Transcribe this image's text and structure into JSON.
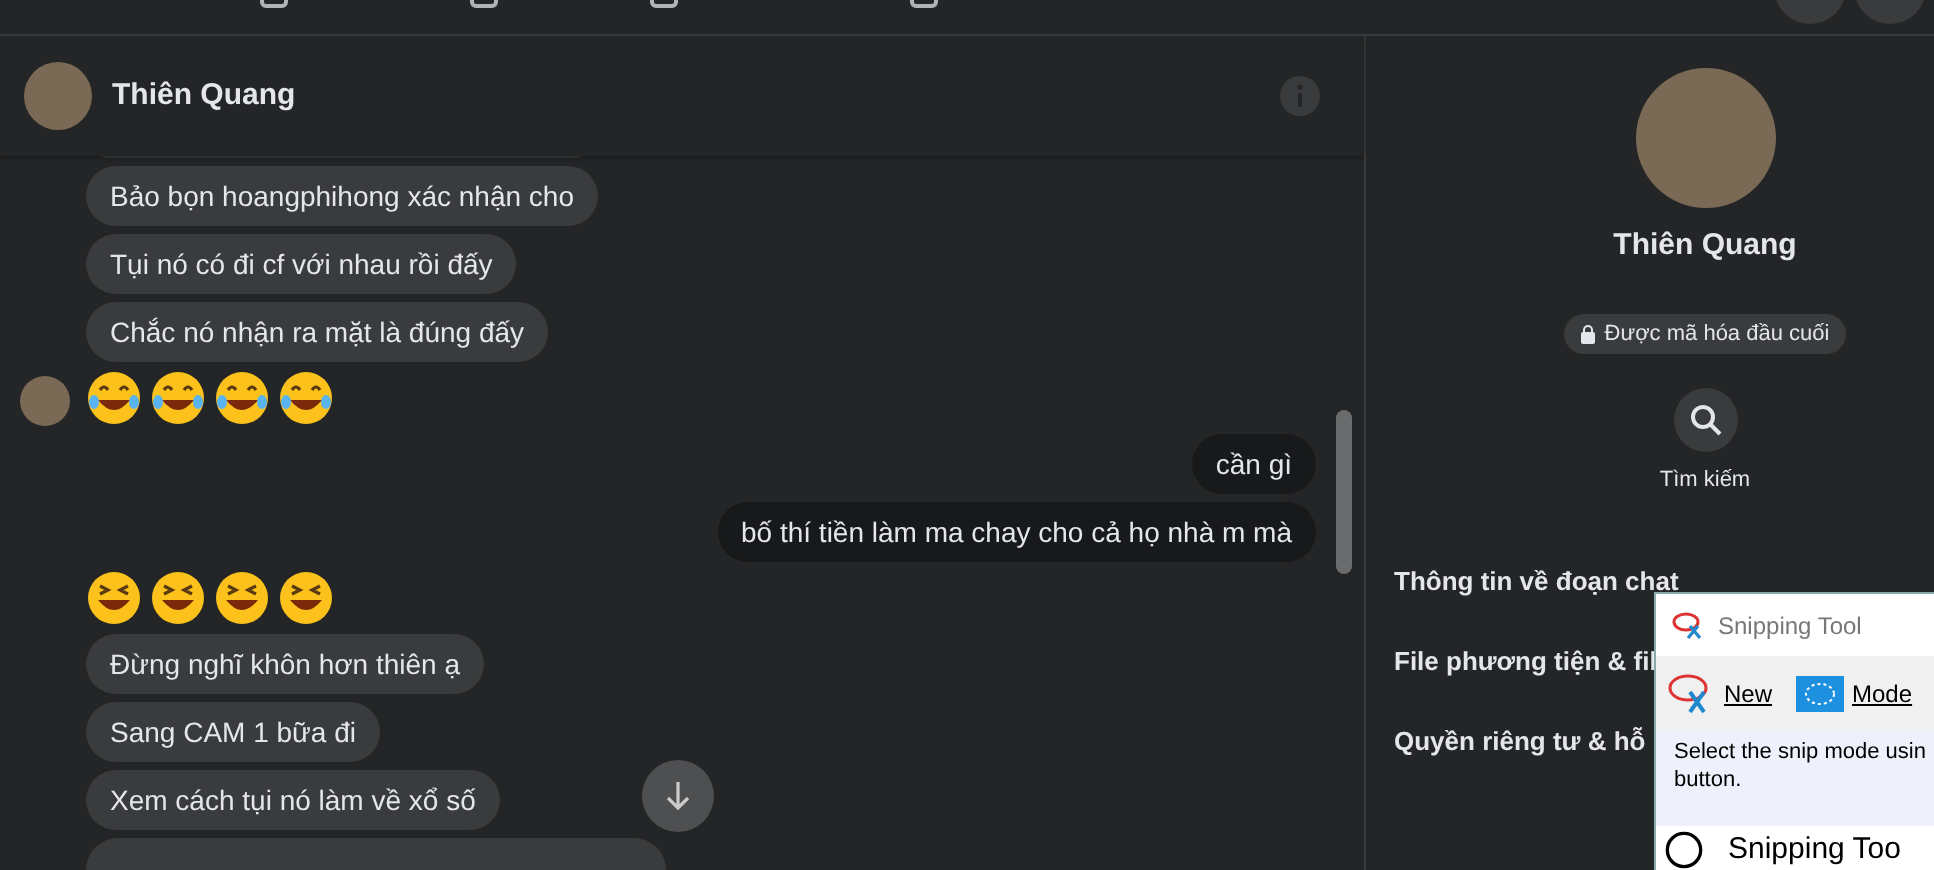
{
  "chat_header": {
    "name": "Thiên Quang"
  },
  "messages": [
    {
      "outgoing": false,
      "kind": "text",
      "text": "Bảo bọn hoangphihong xác nhận cho",
      "avatar": false
    },
    {
      "outgoing": false,
      "kind": "text",
      "text": "Tụi nó có đi cf với nhau rồi đấy",
      "avatar": false
    },
    {
      "outgoing": false,
      "kind": "text",
      "text": "Chắc nó nhận ra mặt là đúng đấy",
      "avatar": false
    },
    {
      "outgoing": false,
      "kind": "emoji",
      "emoji": [
        {
          "kind": "tears"
        },
        {
          "kind": "tears"
        },
        {
          "kind": "tears"
        },
        {
          "kind": "tears"
        }
      ],
      "avatar": true
    },
    {
      "outgoing": true,
      "kind": "text",
      "text": "cần gì"
    },
    {
      "outgoing": true,
      "kind": "text",
      "text": "bố thí tiền làm ma chay cho cả họ nhà m mà"
    },
    {
      "outgoing": false,
      "kind": "emoji",
      "emoji": [
        {
          "kind": "grin"
        },
        {
          "kind": "grin"
        },
        {
          "kind": "grin"
        },
        {
          "kind": "grin"
        }
      ],
      "avatar": false
    },
    {
      "outgoing": false,
      "kind": "text",
      "text": "Đừng nghĩ khôn hơn thiên ạ",
      "avatar": false
    },
    {
      "outgoing": false,
      "kind": "text",
      "text": "Sang CAM 1 bữa đi",
      "avatar": false
    },
    {
      "outgoing": false,
      "kind": "text",
      "text": "Xem cách tụi nó làm về xổ số",
      "avatar": false
    }
  ],
  "profile": {
    "name": "Thiên Quang",
    "encryption_badge": "Được mã hóa đầu cuối",
    "search_label": "Tìm kiếm",
    "sections": [
      "Thông tin về đoạn chat",
      "File phương tiện & fil",
      "Quyền riêng tư & hỗ"
    ]
  },
  "snipping_tool": {
    "title": "Snipping Tool",
    "buttons": [
      {
        "kind": "new",
        "label": "New"
      },
      {
        "kind": "mode",
        "label": "Mode"
      }
    ],
    "description": [
      "Select the snip mode usin",
      "button."
    ],
    "footer": "Snipping Too"
  }
}
